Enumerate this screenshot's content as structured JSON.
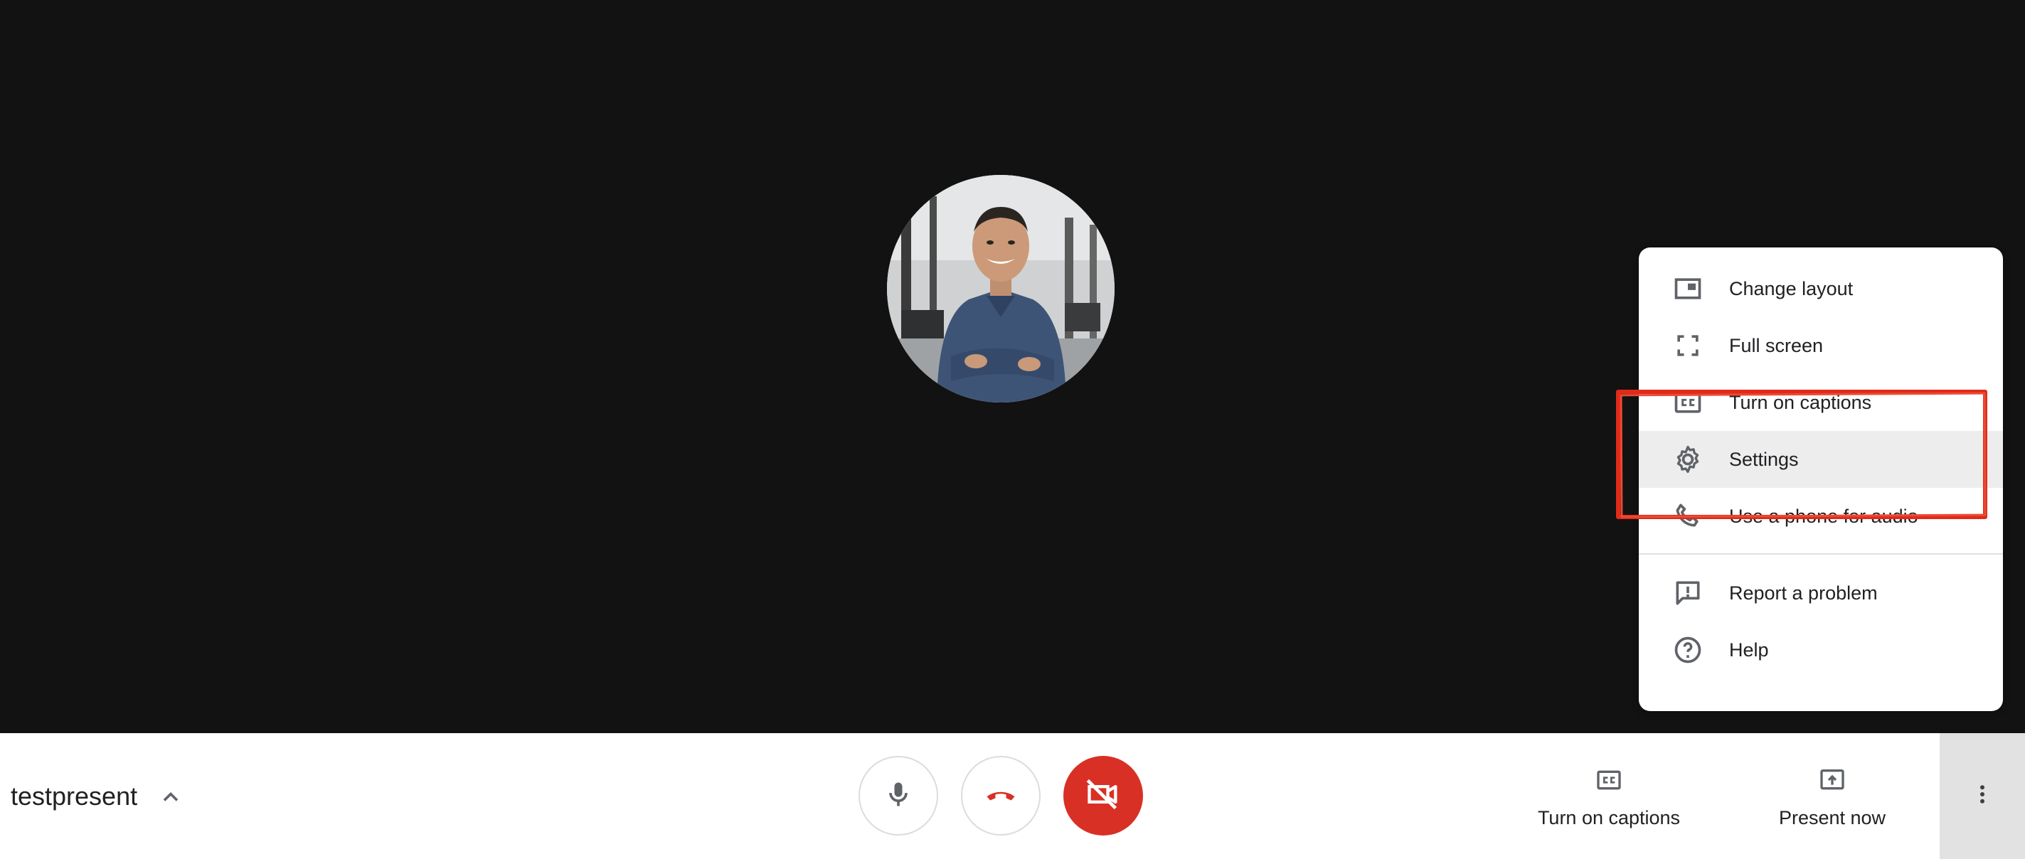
{
  "meeting": {
    "name": "testpresent"
  },
  "menu": {
    "items": [
      {
        "label": "Change layout",
        "icon": "change-layout-icon"
      },
      {
        "label": "Full screen",
        "icon": "fullscreen-icon"
      },
      {
        "label": "Turn on captions",
        "icon": "captions-icon"
      },
      {
        "label": "Settings",
        "icon": "gear-icon"
      },
      {
        "label": "Use a phone for audio",
        "icon": "phone-icon"
      },
      {
        "label": "Report a problem",
        "icon": "report-problem-icon"
      },
      {
        "label": "Help",
        "icon": "help-icon"
      }
    ],
    "highlighted": "Settings"
  },
  "controls": {
    "captions_label": "Turn on captions",
    "present_label": "Present now"
  },
  "colors": {
    "stage_bg": "#121212",
    "hangup_red": "#d93025",
    "annotation_red": "#e02a1a",
    "highlight_bg": "#ededed"
  }
}
